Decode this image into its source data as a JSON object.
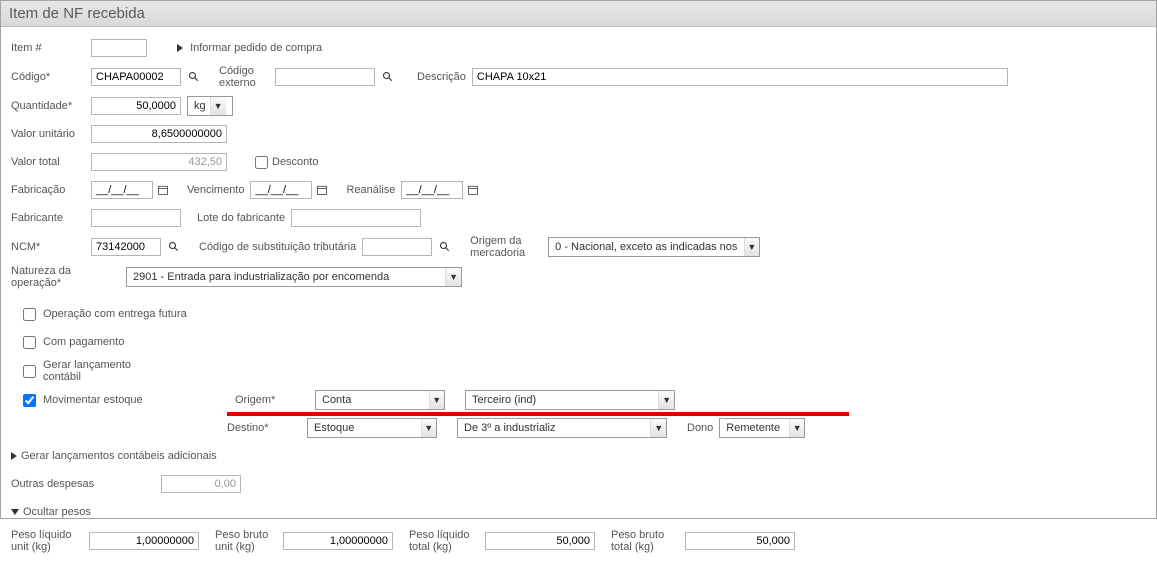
{
  "title": "Item de NF recebida",
  "labels": {
    "item": "Item #",
    "informar_pedido": "Informar pedido de compra",
    "codigo": "Código*",
    "codigo_externo": "Código externo",
    "descricao": "Descrição",
    "quantidade": "Quantidade*",
    "valor_unitario": "Valor unitário",
    "valor_total": "Valor total",
    "desconto": "Desconto",
    "fabricacao": "Fabricação",
    "vencimento": "Vencimento",
    "reanalise": "Reanálise",
    "fabricante": "Fabricante",
    "lote_fabricante": "Lote do fabricante",
    "ncm": "NCM*",
    "cod_subst_trib": "Código de substituição tributária",
    "origem_mercadoria": "Origem da mercadoria",
    "natureza_operacao": "Natureza da operação*",
    "op_entrega_futura": "Operação com entrega futura",
    "com_pagamento": "Com pagamento",
    "gerar_lancamento": "Gerar lançamento contábil",
    "movimentar_estoque": "Movimentar estoque",
    "origem": "Origem*",
    "destino": "Destino*",
    "dono": "Dono",
    "gerar_lanc_adic": "Gerar lançamentos contábeis adicionais",
    "outras_despesas": "Outras despesas",
    "ocultar_pesos": "Ocultar pesos",
    "peso_liq_unit": "Peso líquido unit (kg)",
    "peso_bruto_unit": "Peso bruto unit (kg)",
    "peso_liq_total": "Peso líquido total (kg)",
    "peso_bruto_total": "Peso bruto total (kg)"
  },
  "values": {
    "item": "",
    "codigo": "CHAPA00002",
    "codigo_externo": "",
    "descricao": "CHAPA 10x21",
    "quantidade": "50,0000",
    "unidade": "kg",
    "valor_unitario": "8,6500000000",
    "valor_total": "432,50",
    "fabricacao": "__/__/__",
    "vencimento": "__/__/__",
    "reanalise": "__/__/__",
    "fabricante": "",
    "lote_fabricante": "",
    "ncm": "73142000",
    "cod_subst_trib": "",
    "origem_mercadoria": "0 - Nacional, exceto as indicadas nos",
    "natureza_operacao": "2901 - Entrada para industrialização por encomenda",
    "origem1": "Conta",
    "origem2": "Terceiro (ind)",
    "destino1": "Estoque",
    "destino2": "De 3º a industrializ",
    "dono": "Remetente",
    "outras_despesas": "0,00",
    "peso_liq_unit": "1,00000000",
    "peso_bruto_unit": "1,00000000",
    "peso_liq_total": "50,000",
    "peso_bruto_total": "50,000"
  },
  "checks": {
    "desconto": false,
    "op_entrega_futura": false,
    "com_pagamento": false,
    "gerar_lancamento": false,
    "movimentar_estoque": true
  }
}
